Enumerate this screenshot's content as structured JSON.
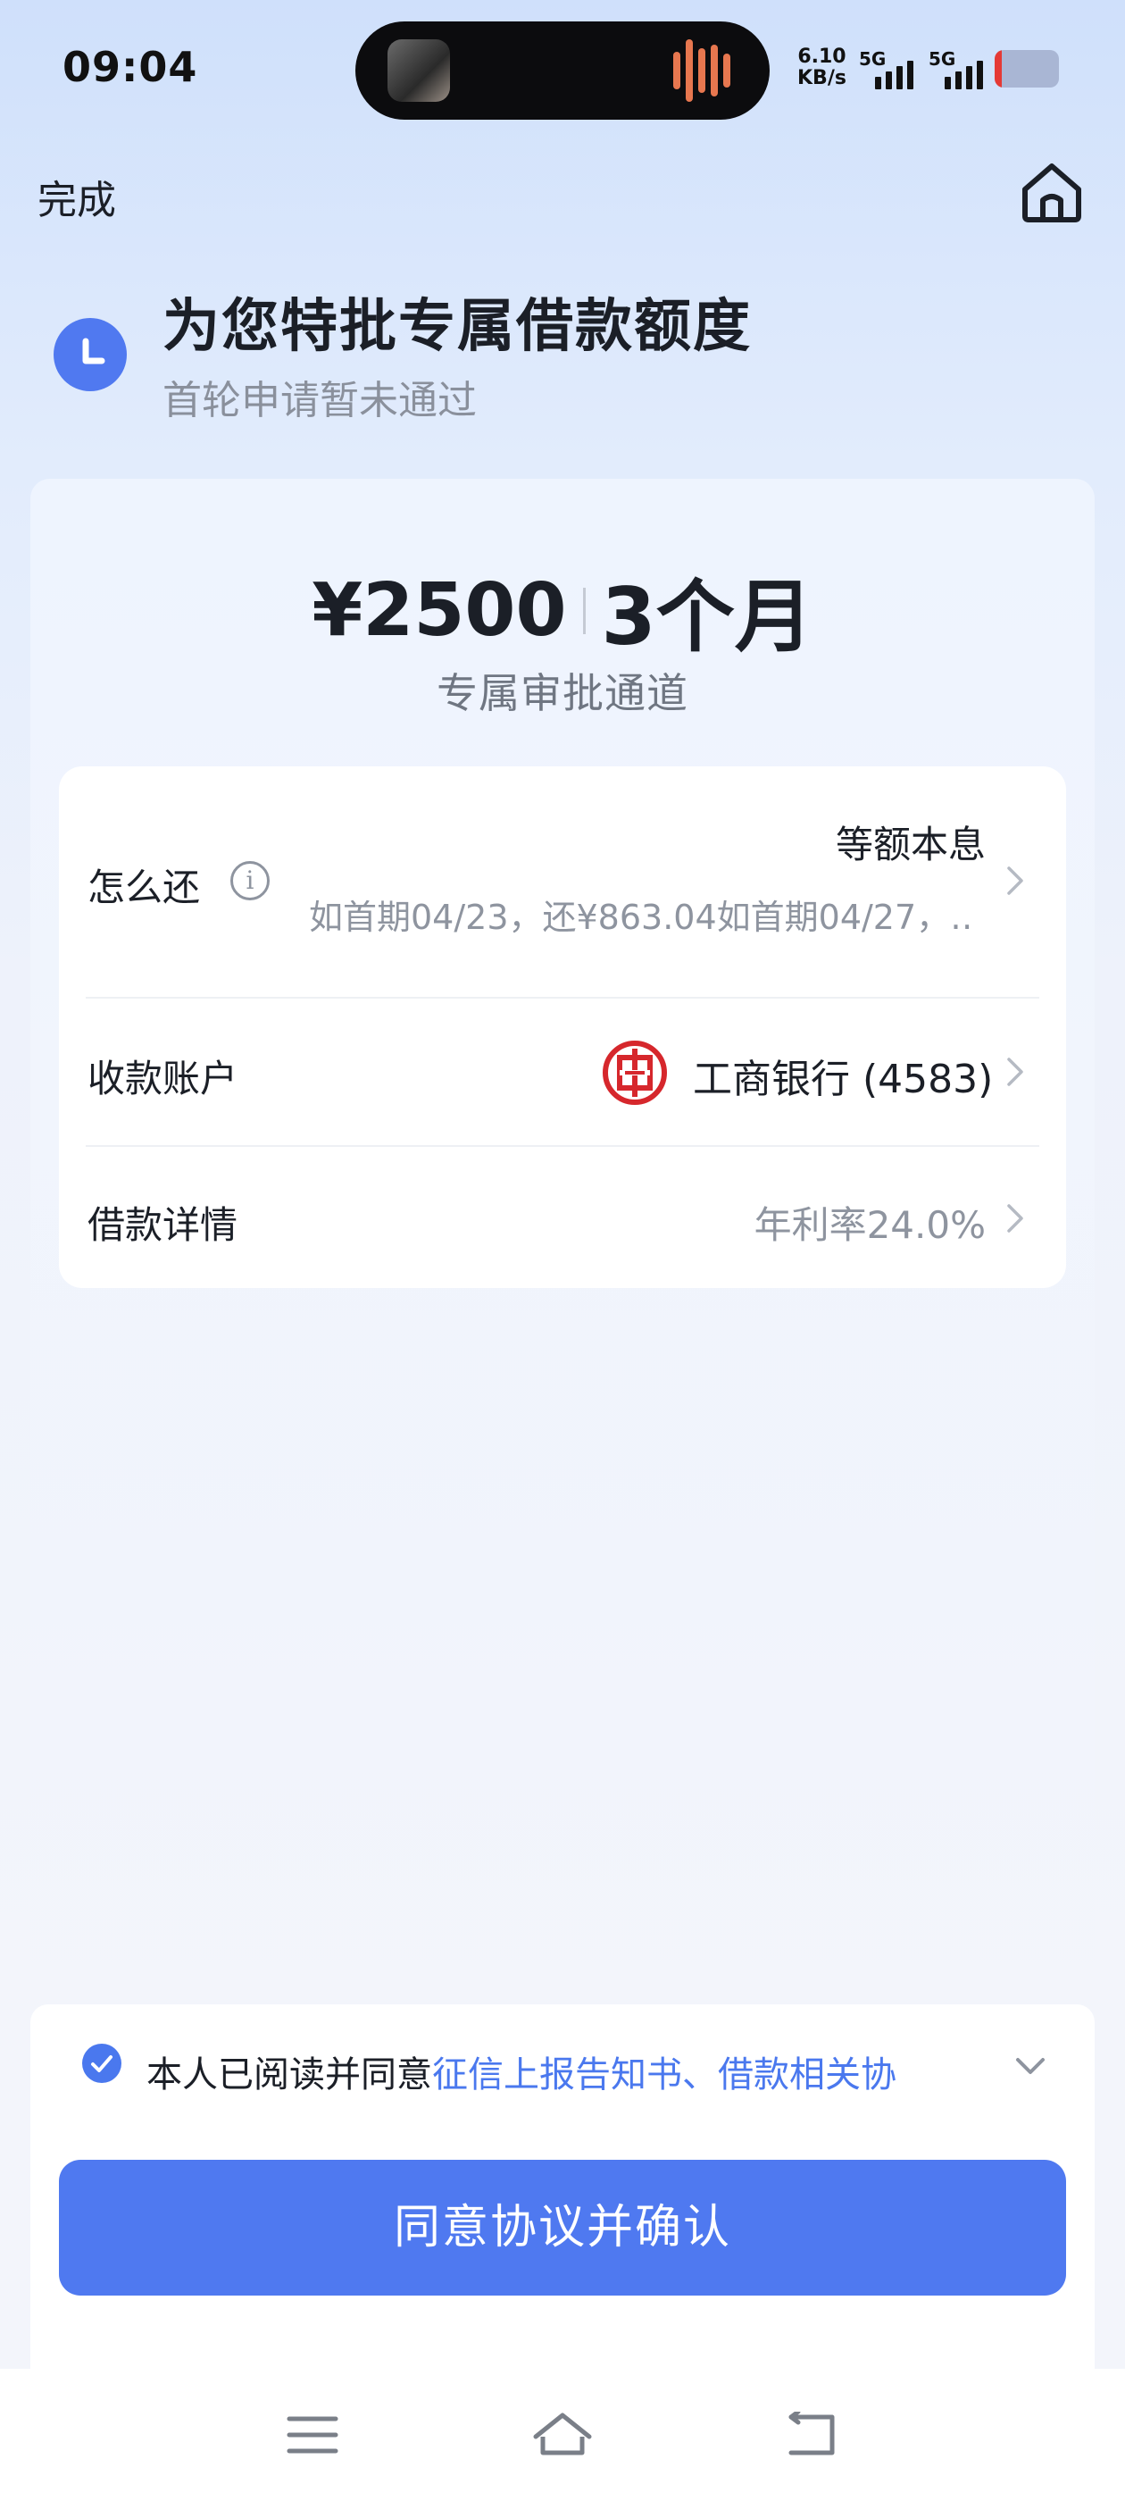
{
  "status_bar": {
    "time": "09:04",
    "net_speed_value": "6.10",
    "net_speed_unit": "KB/s",
    "sim1_label": "5G",
    "sim2_label": "5G"
  },
  "nav": {
    "done_label": "完成",
    "home_icon": "home-icon"
  },
  "header": {
    "title": "为您特批专属借款额度",
    "subtitle": "首轮申请暂未通过"
  },
  "offer": {
    "amount": "¥2500",
    "term": "3个月",
    "channel": "专属审批通道"
  },
  "details": {
    "repay": {
      "label": "怎么还",
      "method": "等额本息",
      "schedule": "如首期04/23，还¥863.04如首期04/27，…"
    },
    "account": {
      "label": "收款账户",
      "bank": "工商银行 (4583)"
    },
    "loan": {
      "label": "借款详情",
      "rate": "年利率24.0%"
    }
  },
  "agreement": {
    "prefix": "本人已阅读并同意",
    "link": "征信上报告知书、借款相关协",
    "checked": true
  },
  "confirm_button": "同意协议并确认",
  "colors": {
    "accent": "#4f79f0",
    "link": "#4a78ee",
    "bank_red": "#d6272c"
  }
}
